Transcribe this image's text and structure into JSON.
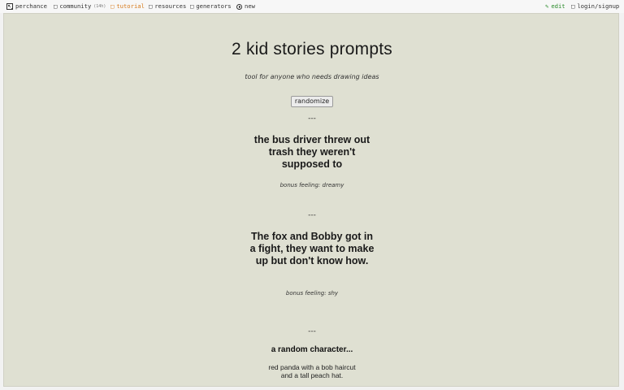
{
  "topbar": {
    "brand": "perchance",
    "community": "community",
    "community_count": "(14h)",
    "tutorial": "tutorial",
    "resources": "resources",
    "generators": "generators",
    "new": "new",
    "edit": "edit",
    "login": "login/signup"
  },
  "page": {
    "title": "2 kid stories prompts",
    "subtitle": "tool for anyone who needs drawing ideas",
    "randomize_label": "randomize"
  },
  "prompts": [
    {
      "divider": "---",
      "text": "the bus driver threw out trash they weren't supposed to",
      "bonus": "bonus feeling: dreamy"
    },
    {
      "divider": "---",
      "text": "The fox and Bobby got in a fight, they want to make up but don't know how.",
      "bonus": "bonus feeling: shy"
    }
  ],
  "character": {
    "divider": "---",
    "heading": "a random character...",
    "description": "red panda with a bob haircut and a tall peach hat."
  },
  "colors": {
    "panel_bg": "#dfe0d2",
    "tutorial_accent": "#d67a1c",
    "edit_accent": "#2a8a2a"
  }
}
